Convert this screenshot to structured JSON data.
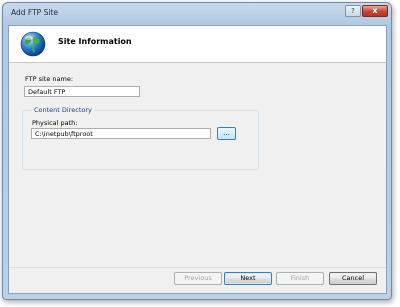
{
  "window": {
    "title": "Add FTP Site",
    "help_label": "?",
    "close_label": "x"
  },
  "header": {
    "title": "Site Information",
    "icon": "globe-icon"
  },
  "form": {
    "site_name_label": "FTP site name:",
    "site_name_value": "Default FTP",
    "content_directory_label": "Content Directory",
    "physical_path_label": "Physical path:",
    "physical_path_value": "C:\\inetpub\\ftproot",
    "browse_label": "..."
  },
  "buttons": {
    "previous": "Previous",
    "next": "Next",
    "finish": "Finish",
    "cancel": "Cancel"
  },
  "colors": {
    "accent": "#3c7fb1",
    "title_bar": "#c7d9ec",
    "close_button": "#c6442f"
  }
}
